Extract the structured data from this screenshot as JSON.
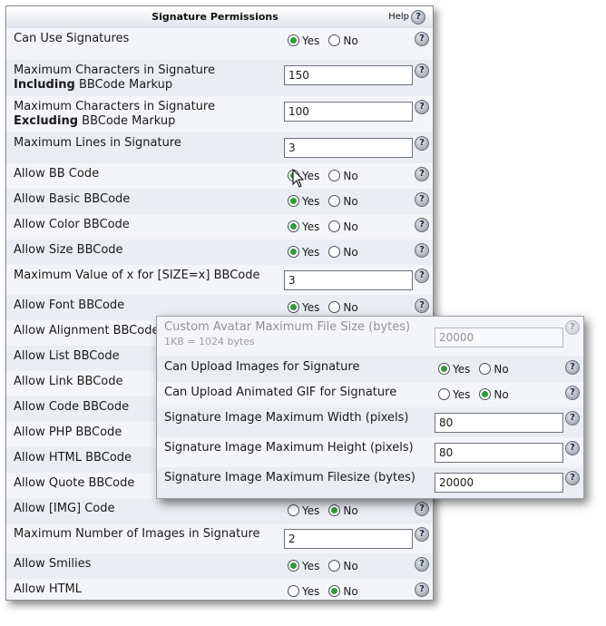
{
  "panel": {
    "title": "Signature Permissions",
    "help_label": "Help",
    "help_icon": "?"
  },
  "radio": {
    "yes": "Yes",
    "no": "No"
  },
  "rows": {
    "r0": {
      "label": "Can Use Signatures",
      "selected": "Yes"
    },
    "r1": {
      "label_line1": "Maximum Characters in Signature",
      "label_bold": "Including",
      "label_rest": " BBCode Markup",
      "value": "150"
    },
    "r2": {
      "label_line1": "Maximum Characters in Signature",
      "label_bold": "Excluding",
      "label_rest": " BBCode Markup",
      "value": "100"
    },
    "r3": {
      "label": "Maximum Lines in Signature",
      "value": "3"
    },
    "r4": {
      "label": "Allow BB Code",
      "selected": "Yes"
    },
    "r5": {
      "label": "Allow Basic BBCode",
      "selected": "Yes"
    },
    "r6": {
      "label": "Allow Color BBCode",
      "selected": "Yes"
    },
    "r7": {
      "label": "Allow Size BBCode",
      "selected": "Yes"
    },
    "r8": {
      "label": "Maximum Value of x for [SIZE=x] BBCode",
      "value": "3"
    },
    "r9": {
      "label": "Allow Font BBCode",
      "selected": "Yes"
    },
    "r10": {
      "label": "Allow Alignment BBCode",
      "selected": "Yes"
    },
    "r11": {
      "label": "Allow List BBCode",
      "selected": "Yes"
    },
    "r12": {
      "label": "Allow Link BBCode",
      "selected": "Yes"
    },
    "r13": {
      "label": "Allow Code BBCode",
      "selected": "Yes"
    },
    "r14": {
      "label": "Allow PHP BBCode",
      "selected": "Yes"
    },
    "r15": {
      "label": "Allow HTML BBCode",
      "selected": "Yes"
    },
    "r16": {
      "label": "Allow Quote BBCode",
      "selected": "Yes"
    },
    "r17": {
      "label": "Allow [IMG] Code",
      "selected": "No"
    },
    "r18": {
      "label": "Maximum Number of Images in Signature",
      "value": "2"
    },
    "r19": {
      "label": "Allow Smilies",
      "selected": "Yes"
    },
    "r20": {
      "label": "Allow HTML",
      "selected": "No"
    }
  },
  "overlay": {
    "o0": {
      "label": "Custom Avatar Maximum File Size (bytes)",
      "sublabel": "1KB = 1024 bytes",
      "value": "20000"
    },
    "o1": {
      "label": "Can Upload Images for Signature",
      "selected": "Yes"
    },
    "o2": {
      "label": "Can Upload Animated GIF for Signature",
      "selected": "No"
    },
    "o3": {
      "label": "Signature Image Maximum Width (pixels)",
      "value": "80"
    },
    "o4": {
      "label": "Signature Image Maximum Height (pixels)",
      "value": "80"
    },
    "o5": {
      "label": "Signature Image Maximum Filesize (bytes)",
      "value": "20000"
    }
  }
}
